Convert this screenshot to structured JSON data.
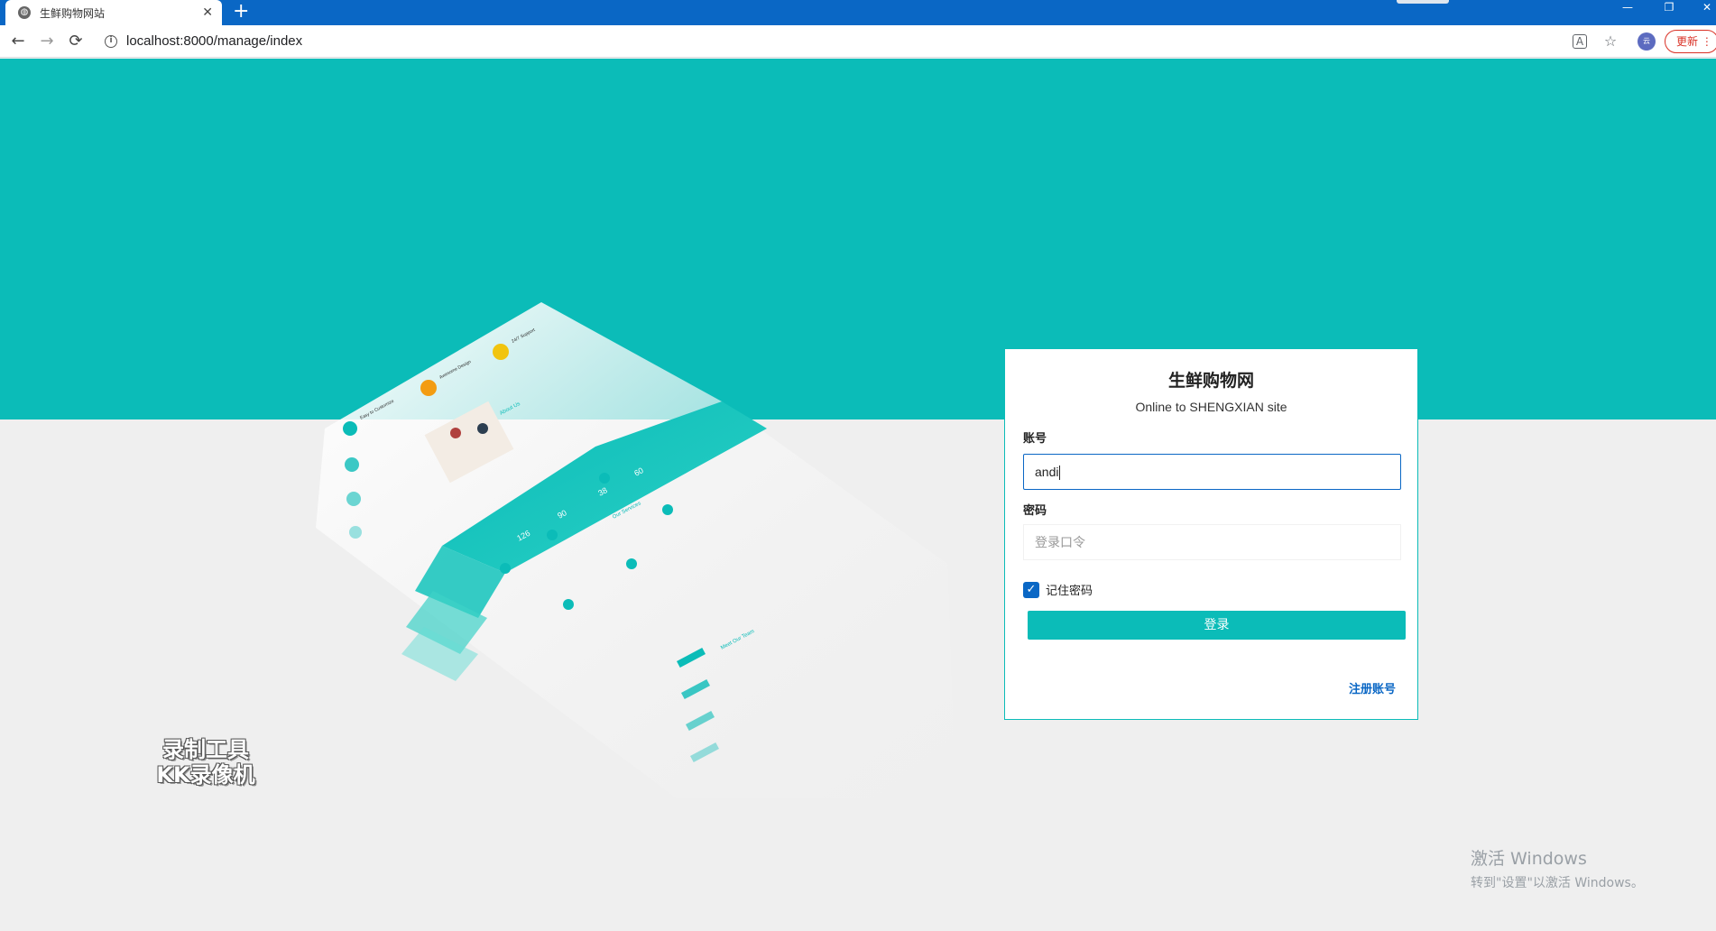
{
  "browser": {
    "tab_title": "生鲜购物网站",
    "tab_close": "✕",
    "new_tab": "+",
    "url": "localhost:8000/manage/index",
    "back_icon": "←",
    "forward_icon": "→",
    "reload_icon": "⟳",
    "translate_icon": "A",
    "star_icon": "☆",
    "avatar_text": "云",
    "update_label": "更新 ⋮",
    "window_controls": {
      "minimize": "—",
      "maximize": "❐",
      "close": "✕"
    }
  },
  "login": {
    "title": "生鲜购物网",
    "subtitle": "Online to SHENGXIAN site",
    "username_label": "账号",
    "username_value": "andi",
    "password_label": "密码",
    "password_placeholder": "登录口令",
    "remember_label": "记住密码",
    "remember_checked": true,
    "submit_label": "登录",
    "register_label": "注册账号"
  },
  "mockup": {
    "stats": [
      "126",
      "90",
      "38",
      "60"
    ],
    "heading_about": "About Us",
    "heading_services": "Our Services",
    "heading_team": "Meet Our Team",
    "feature_titles": [
      "Easy to Customize",
      "Awesome Design",
      "24/7 Support"
    ]
  },
  "overlay": {
    "recorder_line1": "录制工具",
    "recorder_line2": "KK录像机",
    "activate_title": "激活 Windows",
    "activate_sub": "转到\"设置\"以激活 Windows。"
  },
  "colors": {
    "teal": "#0bbcb8",
    "chrome_blue": "#0a67c5",
    "link_blue": "#0a67c5"
  }
}
